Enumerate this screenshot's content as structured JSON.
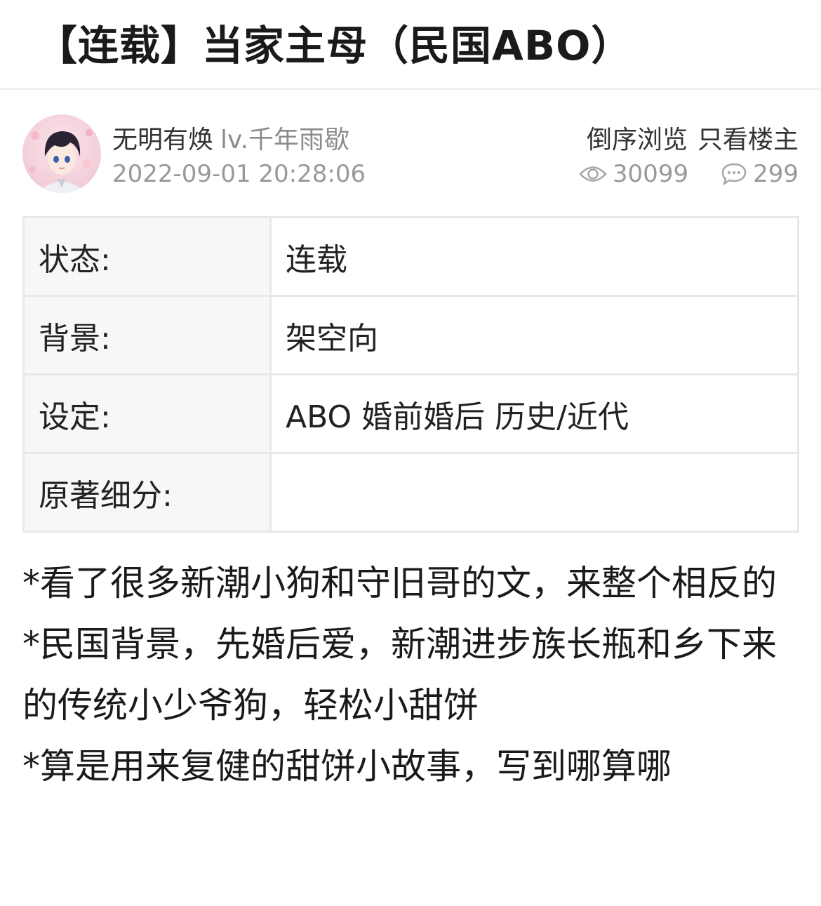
{
  "title": "【连载】当家主母（民国ABO）",
  "author": {
    "name": "无明有焕",
    "level": "lv.千年雨歇",
    "time": "2022-09-01 20:28:06"
  },
  "actions": {
    "reverse": "倒序浏览",
    "author_only": "只看楼主"
  },
  "stats": {
    "views": "30099",
    "comments": "299"
  },
  "info_rows": [
    {
      "label": "状态:",
      "value": "连载"
    },
    {
      "label": "背景:",
      "value": "架空向"
    },
    {
      "label": "设定:",
      "value": "ABO 婚前婚后 历史/近代"
    },
    {
      "label": "原著细分:",
      "value": ""
    }
  ],
  "body_lines": [
    "*看了很多新潮小狗和守旧哥的文，来整个相反的",
    "*民国背景，先婚后爱，新潮进步族长瓶和乡下来的传统小少爷狗，轻松小甜饼",
    "*算是用来复健的甜饼小故事，写到哪算哪"
  ],
  "icons": {
    "views": "eye-icon",
    "comments": "chat-bubble-icon"
  }
}
